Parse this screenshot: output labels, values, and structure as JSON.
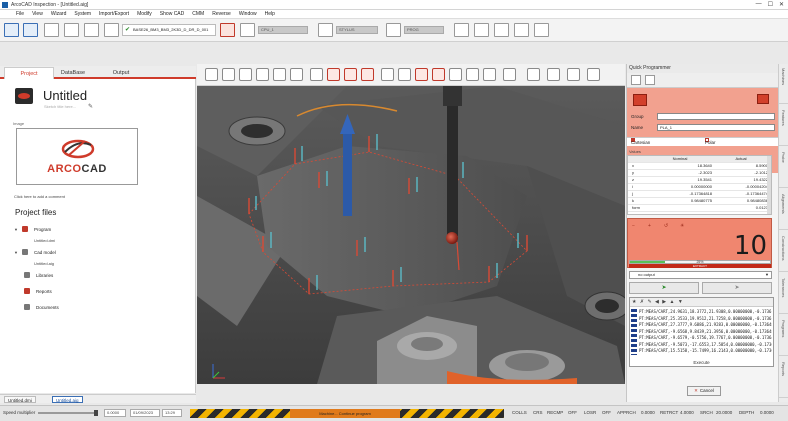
{
  "window": {
    "title": "ArcoCAD Inspection - [Untitled.aig]",
    "controls": [
      "—",
      "☐",
      "✕"
    ]
  },
  "menu": [
    "File",
    "View",
    "Wizard",
    "System",
    "Import/Export",
    "Modify",
    "Show CAD",
    "CMM",
    "Reverse",
    "Window",
    "Help"
  ],
  "toolbar": {
    "program_select": "BASE26_BM3_BM3_2K3D_D_DR_D_001",
    "field_1": "CPU_1",
    "field_2": "STYLUS",
    "field_3": "PROG"
  },
  "left_panel": {
    "tabs": [
      "Project",
      "DataBase",
      "Output"
    ],
    "project_title": "Untitled",
    "project_subtitle": "Sketch title here...",
    "image_label": "Image",
    "logo_text_a": "ARCO",
    "logo_text_b": "CAD",
    "comment_label": "Click here to add a comment",
    "project_files_title": "Project files",
    "tree": [
      {
        "label": "Program",
        "sub": "Untitled.dmi"
      },
      {
        "label": "Cad model",
        "sub": "Untitled.aig"
      },
      {
        "label": "Libraries"
      },
      {
        "label": "Reports"
      },
      {
        "label": "Documents"
      }
    ]
  },
  "file_tabs": [
    "Untitled.dmi",
    "Untitled.aig"
  ],
  "right_panel": {
    "title": "Quick Programmer",
    "group_label": "Group",
    "group_value": "",
    "name_label": "Name",
    "name_value": "PLA_1",
    "options": [
      "Cartesian",
      "Polar"
    ],
    "values_label": "Values",
    "table_headers": [
      "",
      "Nominal",
      "Actual"
    ],
    "table_rows": [
      {
        "k": "x",
        "n": "18.3640",
        "a": "8.5900"
      },
      {
        "k": "y",
        "n": "-2.3023",
        "a": "-2.1012"
      },
      {
        "k": "z",
        "n": "19.3541",
        "a": "19.4322"
      },
      {
        "k": "i",
        "n": "0.00000000",
        "a": "-0.00004204"
      },
      {
        "k": "j",
        "n": "-0.17364818",
        "a": "-0.17364474"
      },
      {
        "k": "k",
        "n": "0.98480775",
        "a": "0.98480836"
      },
      {
        "k": "form",
        "n": "",
        "a": "0.0123"
      }
    ],
    "counter": "10",
    "progress_percent": 25,
    "progress_label": "25%",
    "status_text": "EXTRACT",
    "output_select": "no output",
    "code_tools": "★ ✗ ✎ ◀ ▶ ▲ ▼",
    "code_lines": [
      "PT:MEAS/CART,24.9631,18.3772,21.9308,0.00000000,-0.1736",
      "PT:MEAS/CART,25.3533,19.9512,21.7258,0.00000000,-0.1736",
      "PT:MEAS/CART,27.3777,9.6886,21.9283,0.00000000,-0.173648",
      "PT:MEAS/CART,-9.6568,9.8439,21.3956,0.00000000,-0.173648",
      "PT:MEAS/CART,-9.6579,-0.5756,19.7767,0.00000000,-0.173641",
      "PT:MEAS/CART,-9.5073,-17.6553,17.5854,0.00000000,-0.173640",
      "PT:MEAS/CART,15.5158,-15.7499,16.2143,0.00000000,-0.173648"
    ],
    "execute_label": "Execute",
    "cancel_label": "Cancel"
  },
  "side_tabs": [
    "Machines",
    "Features",
    "Probe",
    "Alignments",
    "Constructions",
    "Tolerances",
    "Programs",
    "Reports"
  ],
  "status_bar": {
    "speed_label": "Speed multiplier",
    "time": "0.0000",
    "date": "01/09/2023",
    "clock": "13:29",
    "hazard_text": "Machine... Continue program",
    "flags": [
      "COLLS",
      "CRS",
      "RECMP",
      "OFF",
      "LOSR",
      "OFF",
      "APPRCH",
      "0.0000",
      "RETRCT",
      "4.0000",
      "SRCH",
      "20.0000",
      "DEPTH",
      "0.0000"
    ]
  }
}
